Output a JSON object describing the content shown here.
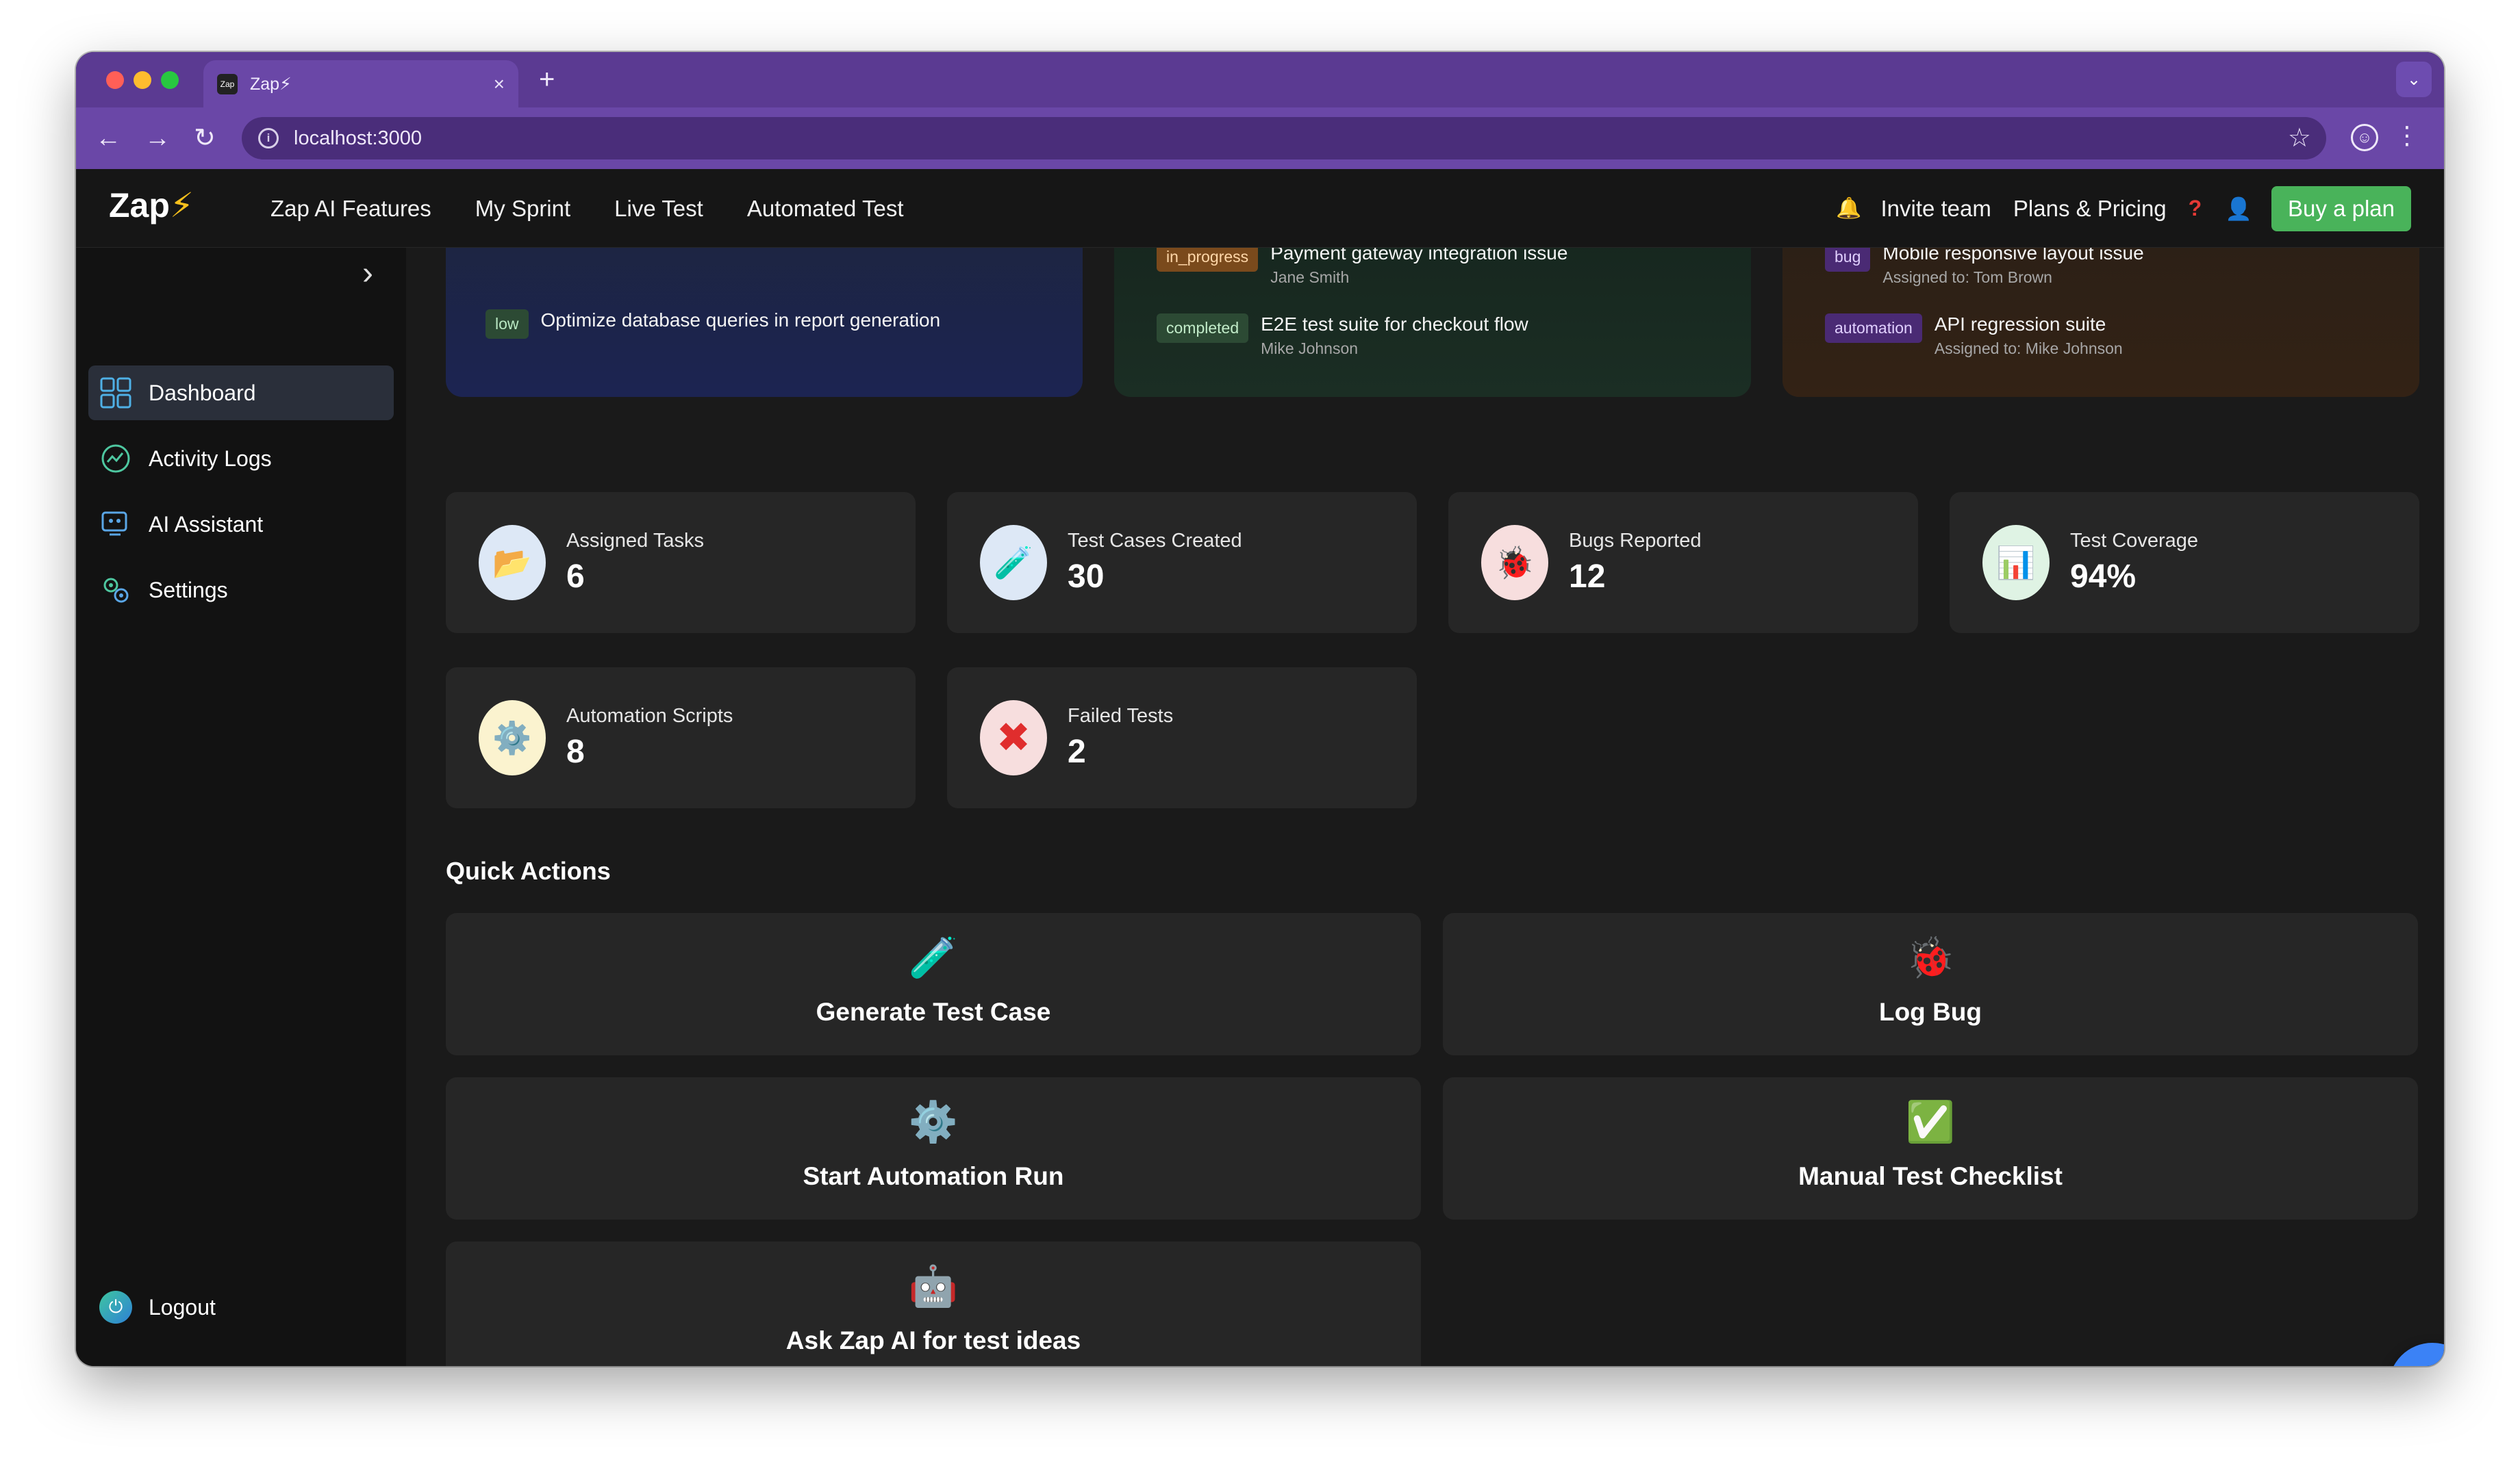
{
  "browser": {
    "tab_title": "Zap⚡",
    "tab_favicon": "Zap",
    "tab_close": "×",
    "new_tab": "+",
    "url": "localhost:3000",
    "tabmenu": "⌄"
  },
  "header": {
    "logo_text": "Zap",
    "logo_bolt": "⚡",
    "nav": [
      "Zap AI Features",
      "My Sprint",
      "Live Test",
      "Automated Test"
    ],
    "invite": "Invite team",
    "pricing": "Plans & Pricing",
    "help": "?",
    "buy": "Buy a plan"
  },
  "sidebar": {
    "items": [
      {
        "label": "Dashboard",
        "icon": "dashboard-icon"
      },
      {
        "label": "Activity Logs",
        "icon": "activity-icon"
      },
      {
        "label": "AI Assistant",
        "icon": "ai-assistant-icon"
      },
      {
        "label": "Settings",
        "icon": "settings-icon"
      }
    ],
    "logout": "Logout"
  },
  "panels": {
    "blue": {
      "rows": [
        {
          "tag": "low",
          "title": "Optimize database queries in report generation"
        }
      ]
    },
    "green": {
      "rows": [
        {
          "tag": "in_progress",
          "title": "Payment gateway integration issue",
          "sub": "Jane Smith"
        },
        {
          "tag": "completed",
          "title": "E2E test suite for checkout flow",
          "sub": "Mike Johnson"
        }
      ]
    },
    "orange": {
      "rows": [
        {
          "tag": "bug",
          "title": "Mobile responsive layout issue",
          "sub": "Assigned to: Tom Brown"
        },
        {
          "tag": "automation",
          "title": "API regression suite",
          "sub": "Assigned to: Mike Johnson"
        }
      ]
    }
  },
  "stats": [
    {
      "label": "Assigned Tasks",
      "value": "6",
      "icon": "📂",
      "icon_name": "folder-icon",
      "bg": "#dde8f6"
    },
    {
      "label": "Test Cases Created",
      "value": "30",
      "icon": "🧪",
      "icon_name": "test-tube-icon",
      "bg": "#dde8f6"
    },
    {
      "label": "Bugs Reported",
      "value": "12",
      "icon": "🐞",
      "icon_name": "bug-icon",
      "bg": "#f7dede"
    },
    {
      "label": "Test Coverage",
      "value": "94%",
      "icon": "📊",
      "icon_name": "chart-icon",
      "bg": "#dff3e4"
    },
    {
      "label": "Automation Scripts",
      "value": "8",
      "icon": "⚙️",
      "icon_name": "gear-icon",
      "bg": "#fbf3cf"
    },
    {
      "label": "Failed Tests",
      "value": "2",
      "icon": "✖",
      "icon_name": "x-icon",
      "bg": "#f7dede"
    }
  ],
  "quick_actions": {
    "title": "Quick Actions",
    "items": [
      {
        "label": "Generate Test Case",
        "icon": "🧪",
        "icon_name": "test-tube-icon"
      },
      {
        "label": "Log Bug",
        "icon": "🐞",
        "icon_name": "bug-icon"
      },
      {
        "label": "Start Automation Run",
        "icon": "⚙️",
        "icon_name": "gear-icon"
      },
      {
        "label": "Manual Test Checklist",
        "icon": "✅",
        "icon_name": "checkbox-icon"
      },
      {
        "label": "Ask Zap AI for test ideas",
        "icon": "🤖",
        "icon_name": "robot-icon"
      }
    ]
  }
}
